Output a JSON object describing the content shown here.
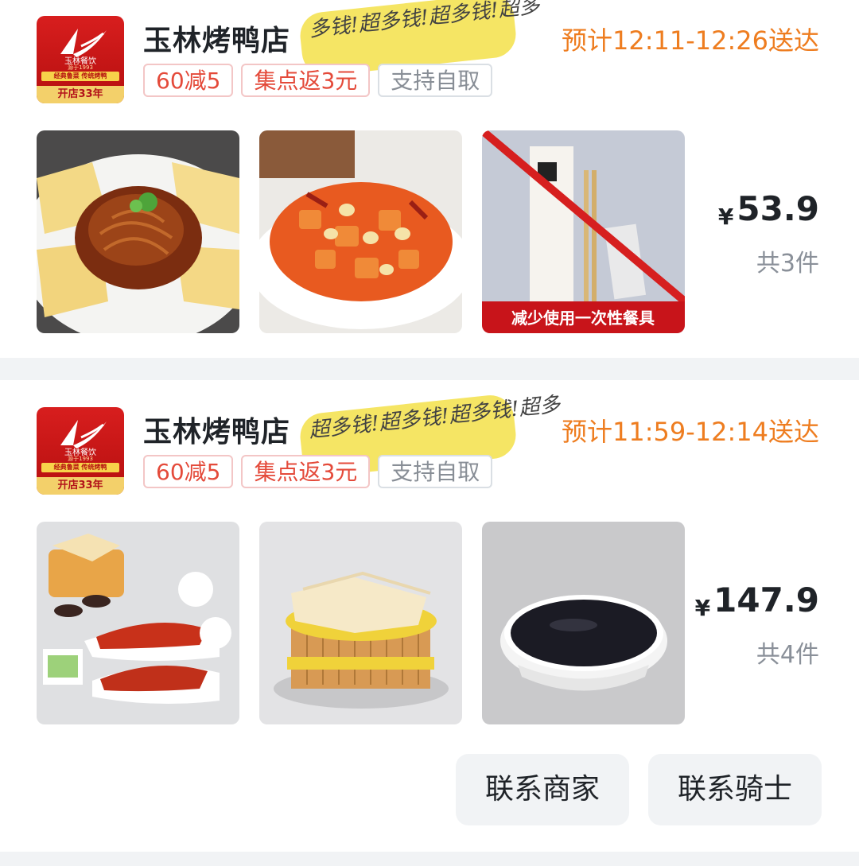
{
  "orders": [
    {
      "store_name": "玉林烤鸭店",
      "scribble_text": "多钱!超多钱!超多钱!超多",
      "eta": "预计12:11-12:26送达",
      "tags": [
        "60减5",
        "集点返3元",
        "支持自取"
      ],
      "price_currency": "¥",
      "price_value": "53.9",
      "item_count": "共3件",
      "logo": {
        "brand": "玉林餐饮",
        "est": "源于1993",
        "slogan": "经典鲁菜 传统烤鸭",
        "years": "开店33年"
      },
      "items": [
        {
          "icon": "shredded-pork-dish-icon"
        },
        {
          "icon": "kung-pao-chicken-icon"
        },
        {
          "icon": "disposable-utensils-icon",
          "caption": "减少使用一次性餐具"
        }
      ]
    },
    {
      "store_name": "玉林烤鸭店",
      "scribble_text": "超多钱!超多钱!超多钱!超多",
      "eta": "预计11:59-12:14送达",
      "tags": [
        "60减5",
        "集点返3元",
        "支持自取"
      ],
      "price_currency": "¥",
      "price_value": "147.9",
      "item_count": "共4件",
      "logo": {
        "brand": "玉林餐饮",
        "est": "源于1993",
        "slogan": "经典鲁菜 传统烤鸭",
        "years": "开店33年"
      },
      "items": [
        {
          "icon": "roast-duck-platter-icon"
        },
        {
          "icon": "pancake-steamer-icon"
        },
        {
          "icon": "sauce-dish-icon"
        }
      ]
    }
  ],
  "actions": {
    "contact_merchant": "联系商家",
    "contact_rider": "联系骑士"
  },
  "colors": {
    "accent_orange": "#ee7d20",
    "tag_red": "#e44a3a",
    "logo_red": "#c8141a"
  }
}
